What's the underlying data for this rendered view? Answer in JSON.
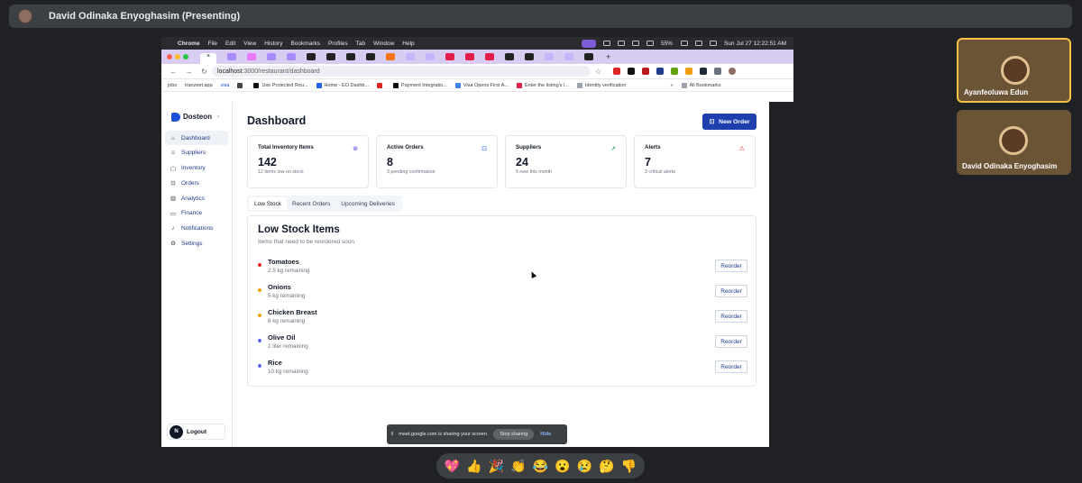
{
  "meet": {
    "presenter": "David Odinaka Enyoghasim (Presenting)",
    "participants": [
      {
        "name": "Ayanfeoluwa Edun"
      },
      {
        "name": "David Odinaka Enyoghasim"
      }
    ],
    "reactions": [
      "💖",
      "👍",
      "🎉",
      "👏",
      "😂",
      "😮",
      "😢",
      "🤔",
      "👎"
    ],
    "share_text": "meet.google.com is sharing your screen.",
    "stop_label": "Stop sharing",
    "hide_label": "Hide"
  },
  "mac": {
    "menus": [
      "Chrome",
      "File",
      "Edit",
      "View",
      "History",
      "Bookmarks",
      "Profiles",
      "Tab",
      "Window",
      "Help"
    ],
    "battery": "55%",
    "clock": "Sun Jul 27  12:22:51 AM"
  },
  "browser": {
    "url_host": "localhost",
    "url_path": ":3000/restaurant/dashboard",
    "bookmarks": [
      "jobs",
      "tranzeet.app",
      "visa",
      "Use Protected Rou...",
      "Home - EO Dashb...",
      "Payment Integratio...",
      "Visa Opens First A...",
      "Enter the listing's l...",
      "Identity verification"
    ],
    "all_bookmarks": "All Bookmarks"
  },
  "app": {
    "brand": "Dosteon",
    "nav": [
      {
        "label": "Dashboard",
        "icon": "home-icon",
        "glyph": "⌂"
      },
      {
        "label": "Suppliers",
        "icon": "users-icon",
        "glyph": "👥"
      },
      {
        "label": "Inventory",
        "icon": "box-icon",
        "glyph": "▢"
      },
      {
        "label": "Orders",
        "icon": "cart-icon",
        "glyph": "🛒"
      },
      {
        "label": "Analytics",
        "icon": "chart-icon",
        "glyph": "▥"
      },
      {
        "label": "Finance",
        "icon": "wallet-icon",
        "glyph": "▭"
      },
      {
        "label": "Notifications",
        "icon": "bell-icon",
        "glyph": "🔔"
      },
      {
        "label": "Settings",
        "icon": "gear-icon",
        "glyph": "⚙"
      }
    ],
    "logout": {
      "avatar": "N",
      "label": "Logout"
    },
    "page_title": "Dashboard",
    "new_order": "New Order",
    "cards": [
      {
        "label": "Total Inventory Items",
        "value": "142",
        "sub": "12 items low on stock",
        "icon": "package-icon",
        "glyph": "⊛",
        "color": "#4f46e5"
      },
      {
        "label": "Active Orders",
        "value": "8",
        "sub": "3 pending confirmation",
        "icon": "cart-icon",
        "glyph": "🛒",
        "color": "#2563eb"
      },
      {
        "label": "Suppliers",
        "value": "24",
        "sub": "5 new this month",
        "icon": "trend-up-icon",
        "glyph": "↗",
        "color": "#16a34a"
      },
      {
        "label": "Alerts",
        "value": "7",
        "sub": "3 critical alerts",
        "icon": "warning-icon",
        "glyph": "⚠",
        "color": "#dc2626"
      }
    ],
    "tabs": [
      "Low Stock",
      "Recent Orders",
      "Upcoming Deliveries"
    ],
    "panel_title": "Low Stock Items",
    "panel_sub": "Items that need to be reordered soon",
    "reorder_label": "Reorder",
    "low_stock": [
      {
        "name": "Tomatoes",
        "qty": "2.5 kg remaining",
        "color": "#dc2626"
      },
      {
        "name": "Onions",
        "qty": "5 kg remaining",
        "color": "#f59e0b"
      },
      {
        "name": "Chicken Breast",
        "qty": "8 kg remaining",
        "color": "#f59e0b"
      },
      {
        "name": "Olive Oil",
        "qty": "1 liter remaining",
        "color": "#6366f1"
      },
      {
        "name": "Rice",
        "qty": "10 kg remaining",
        "color": "#6366f1"
      }
    ]
  }
}
